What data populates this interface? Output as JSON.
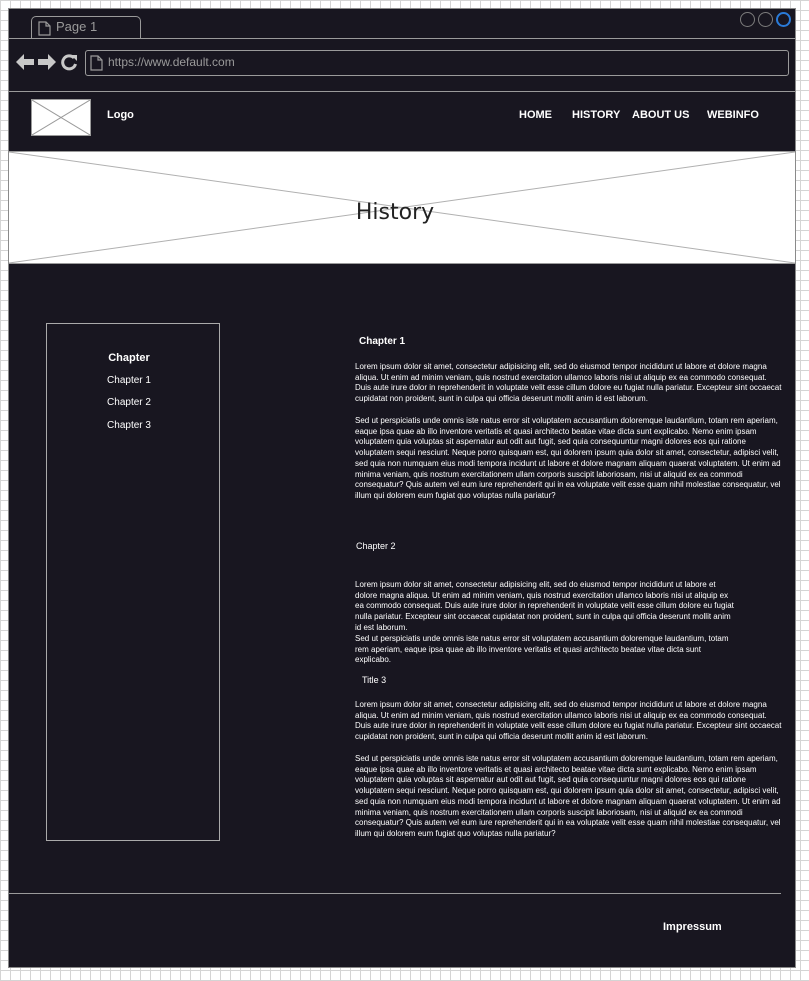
{
  "browser": {
    "tab_title": "Page 1",
    "url": "https://www.default.com"
  },
  "header": {
    "logo_label": "Logo",
    "nav": [
      "HOME",
      "HISTORY",
      "ABOUT US",
      "WEBINFO"
    ]
  },
  "hero": {
    "title": "History"
  },
  "sidebar": {
    "title": "Chapter",
    "items": [
      "Chapter 1",
      "Chapter 2",
      "Chapter 3"
    ]
  },
  "content": {
    "sections": [
      {
        "heading": "Chapter 1",
        "paragraphs": [
          "Lorem ipsum dolor sit amet, consectetur adipisicing elit, sed do eiusmod tempor incididunt ut labore et dolore magna aliqua. Ut enim ad minim veniam, quis nostrud exercitation ullamco laboris nisi ut aliquip ex ea commodo consequat. Duis aute irure dolor in reprehenderit in voluptate velit esse cillum dolore eu fugiat nulla pariatur. Excepteur sint occaecat cupidatat non proident, sunt in culpa qui officia deserunt mollit anim id est laborum.",
          "Sed ut perspiciatis unde omnis iste natus error sit voluptatem accusantium doloremque laudantium, totam rem aperiam, eaque ipsa quae ab illo inventore veritatis et quasi architecto beatae vitae dicta sunt explicabo. Nemo enim ipsam voluptatem quia voluptas sit aspernatur aut odit aut fugit, sed quia consequuntur magni dolores eos qui ratione voluptatem sequi nesciunt. Neque porro quisquam est, qui dolorem ipsum quia dolor sit amet, consectetur, adipisci velit, sed quia non numquam eius modi tempora incidunt ut labore et dolore magnam aliquam quaerat voluptatem. Ut enim ad minima veniam, quis nostrum exercitationem ullam corporis suscipit laboriosam, nisi ut aliquid ex ea commodi consequatur? Quis autem vel eum iure reprehenderit qui in ea voluptate velit esse quam nihil molestiae consequatur, vel illum qui dolorem eum fugiat quo voluptas nulla pariatur?"
        ]
      },
      {
        "heading": "Chapter 2",
        "paragraphs": [
          "Lorem ipsum dolor sit amet, consectetur adipisicing elit, sed do eiusmod tempor incididunt ut labore et dolore magna aliqua. Ut enim ad minim veniam, quis nostrud exercitation ullamco laboris nisi ut aliquip ex ea commodo consequat. Duis aute irure dolor in reprehenderit in voluptate velit esse cillum dolore eu fugiat nulla pariatur. Excepteur sint occaecat cupidatat non proident, sunt in culpa qui officia deserunt mollit anim id est laborum.",
          "Sed ut perspiciatis unde omnis iste natus error sit voluptatem accusantium doloremque laudantium, totam rem aperiam, eaque ipsa quae ab illo inventore veritatis et quasi architecto beatae vitae dicta sunt explicabo."
        ]
      },
      {
        "heading": "Title 3",
        "paragraphs": [
          "Lorem ipsum dolor sit amet, consectetur adipisicing elit, sed do eiusmod tempor incididunt ut labore et dolore magna aliqua. Ut enim ad minim veniam, quis nostrud exercitation ullamco laboris nisi ut aliquip ex ea commodo consequat. Duis aute irure dolor in reprehenderit in voluptate velit esse cillum dolore eu fugiat nulla pariatur. Excepteur sint occaecat cupidatat non proident, sunt in culpa qui officia deserunt mollit anim id est laborum.",
          "Sed ut perspiciatis unde omnis iste natus error sit voluptatem accusantium doloremque laudantium, totam rem aperiam, eaque ipsa quae ab illo inventore veritatis et quasi architecto beatae vitae dicta sunt explicabo. Nemo enim ipsam voluptatem quia voluptas sit aspernatur aut odit aut fugit, sed quia consequuntur magni dolores eos qui ratione voluptatem sequi nesciunt. Neque porro quisquam est, qui dolorem ipsum quia dolor sit amet, consectetur, adipisci velit, sed quia non numquam eius modi tempora incidunt ut labore et dolore magnam aliquam quaerat voluptatem. Ut enim ad minima veniam, quis nostrum exercitationem ullam corporis suscipit laboriosam, nisi ut aliquid ex ea commodi consequatur? Quis autem vel eum iure reprehenderit qui in ea voluptate velit esse quam nihil molestiae consequatur, vel illum qui dolorem eum fugiat quo voluptas nulla pariatur?"
        ]
      }
    ]
  },
  "footer": {
    "link": "Impressum"
  }
}
